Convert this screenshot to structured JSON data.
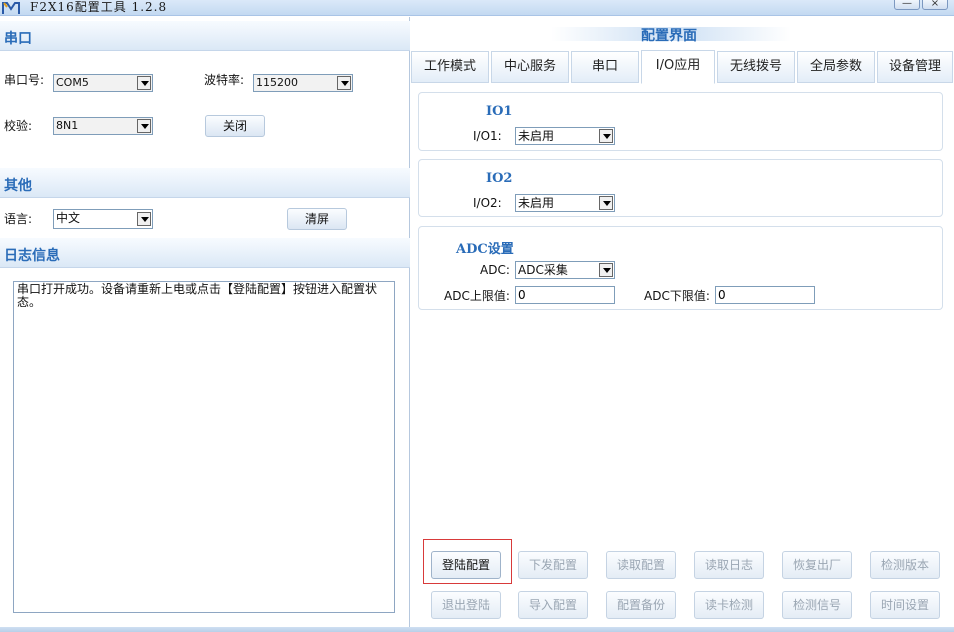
{
  "window": {
    "title": "F2X16配置工具 1.2.8",
    "min_glyph": "—",
    "close_glyph": "×"
  },
  "left": {
    "serial_section": "串口",
    "port_label": "串口号:",
    "port_value": "COM5",
    "baud_label": "波特率:",
    "baud_value": "115200",
    "parity_label": "校验:",
    "parity_value": "8N1",
    "close_button": "关闭",
    "other_section": "其他",
    "language_label": "语言:",
    "language_value": "中文",
    "clear_button": "清屏",
    "log_section": "日志信息",
    "log_text": "串口打开成功。设备请重新上电或点击【登陆配置】按钮进入配置状态。"
  },
  "right": {
    "title": "配置界面",
    "tabs": [
      {
        "label": "工作模式"
      },
      {
        "label": "中心服务"
      },
      {
        "label": "串口"
      },
      {
        "label": "I/O应用"
      },
      {
        "label": "无线拨号"
      },
      {
        "label": "全局参数"
      },
      {
        "label": "设备管理"
      }
    ],
    "io1": {
      "title": "IO1",
      "label": "I/O1:",
      "value": "未启用"
    },
    "io2": {
      "title": "IO2",
      "label": "I/O2:",
      "value": "未启用"
    },
    "adc": {
      "title": "ADC设置",
      "label": "ADC:",
      "value": "ADC采集",
      "upper_label": "ADC上限值:",
      "upper_value": "0",
      "lower_label": "ADC下限值:",
      "lower_value": "0"
    },
    "buttons_row1": [
      {
        "label": "登陆配置"
      },
      {
        "label": "下发配置"
      },
      {
        "label": "读取配置"
      },
      {
        "label": "读取日志"
      },
      {
        "label": "恢复出厂"
      },
      {
        "label": "检测版本"
      }
    ],
    "buttons_row2": [
      {
        "label": "退出登陆"
      },
      {
        "label": "导入配置"
      },
      {
        "label": "配置备份"
      },
      {
        "label": "读卡检测"
      },
      {
        "label": "检测信号"
      },
      {
        "label": "时间设置"
      }
    ]
  }
}
